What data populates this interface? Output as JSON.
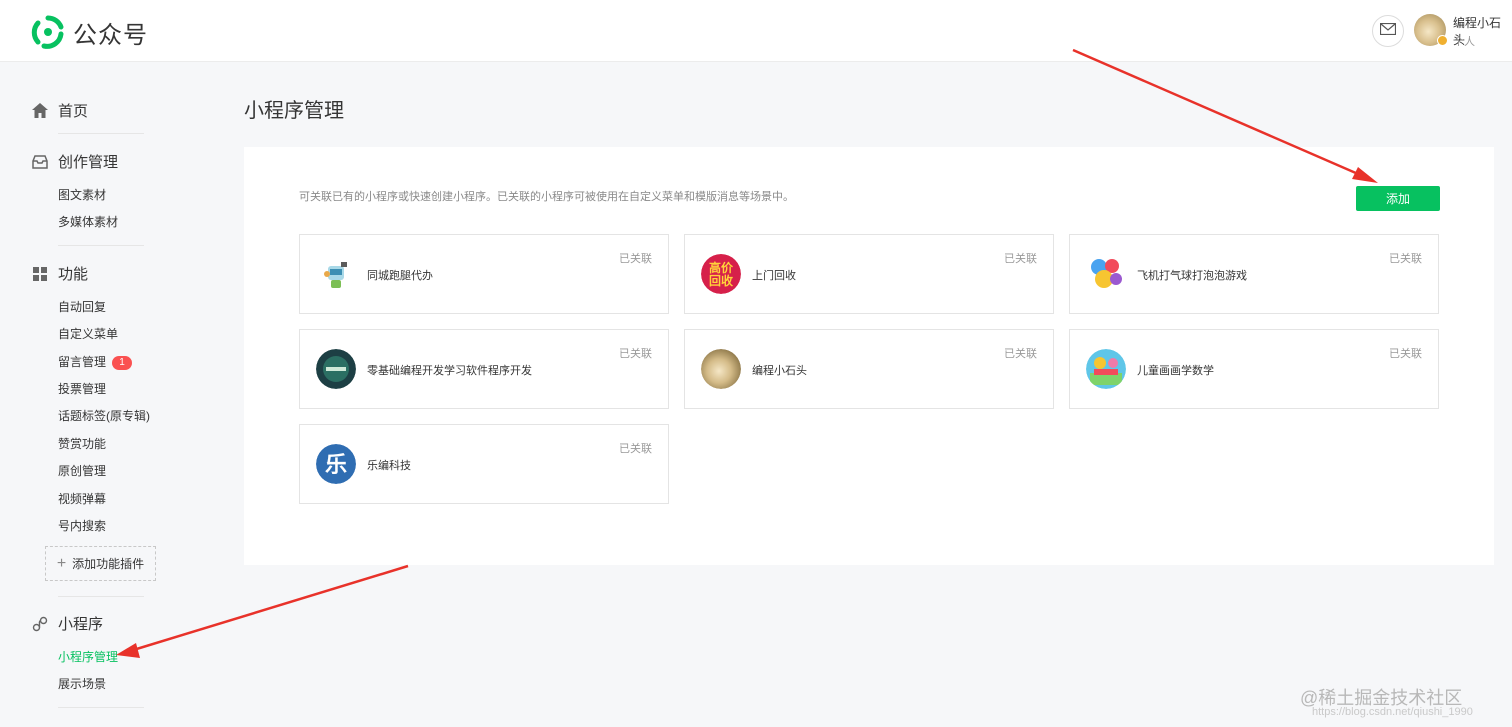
{
  "header": {
    "brand": "公众号",
    "user_name": "编程小石头",
    "user_type": "个人",
    "icons": {
      "logo": "wechat-mp-logo-icon",
      "mail": "mail-icon"
    },
    "accent_color": "#07c160"
  },
  "sidebar": {
    "home": "首页",
    "create": {
      "title": "创作管理",
      "items": [
        "图文素材",
        "多媒体素材"
      ]
    },
    "features": {
      "title": "功能",
      "items": [
        "自动回复",
        "自定义菜单",
        "留言管理",
        "投票管理",
        "话题标签(原专辑)",
        "赞赏功能",
        "原创管理",
        "视频弹幕",
        "号内搜索"
      ],
      "message_badge": "1",
      "add_plugin": "添加功能插件"
    },
    "miniprogram": {
      "title": "小程序",
      "items": [
        "小程序管理",
        "展示场景"
      ],
      "active": "小程序管理"
    }
  },
  "main": {
    "title": "小程序管理",
    "description": "可关联已有的小程序或快速创建小程序。已关联的小程序可被使用在自定义菜单和模版消息等场景中。",
    "add_button": "添加",
    "cards": [
      {
        "name": "同城跑腿代办",
        "status": "已关联",
        "icon": "robot-icon"
      },
      {
        "name": "上门回收",
        "status": "已关联",
        "icon": "recycle-icon"
      },
      {
        "name": "飞机打气球打泡泡游戏",
        "status": "已关联",
        "icon": "balloons-icon"
      },
      {
        "name": "零基础编程开发学习软件程序开发",
        "status": "已关联",
        "icon": "coding-icon"
      },
      {
        "name": "编程小石头",
        "status": "已关联",
        "icon": "stone-avatar-icon"
      },
      {
        "name": "儿童画画学数学",
        "status": "已关联",
        "icon": "kids-math-icon"
      },
      {
        "name": "乐编科技",
        "status": "已关联",
        "icon": "le-logo-icon"
      }
    ]
  },
  "watermark": {
    "text": "@稀土掘金技术社区",
    "sub": "https://blog.csdn.net/qiushi_1990"
  }
}
